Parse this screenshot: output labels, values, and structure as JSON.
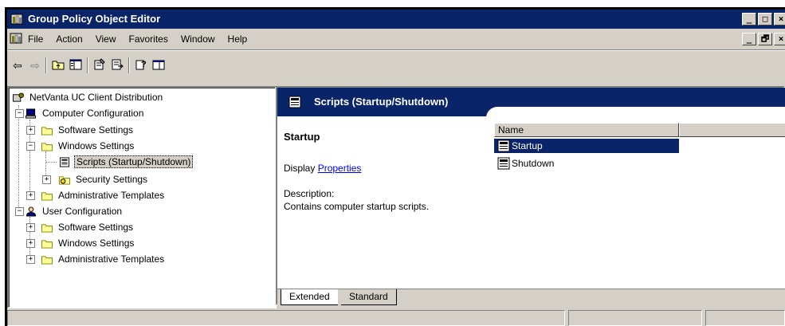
{
  "window": {
    "title": "Group Policy Object Editor",
    "buttons": {
      "minimize": "_",
      "maximize": "□",
      "close": "×"
    }
  },
  "menubar": {
    "items": [
      "File",
      "Action",
      "View",
      "Favorites",
      "Window",
      "Help"
    ],
    "mdi_buttons": {
      "minimize": "_",
      "restore": "🗗",
      "close": "×"
    }
  },
  "toolbar": {
    "back_glyph": "⇦",
    "forward_glyph": "⇨"
  },
  "tree": {
    "root": "NetVanta UC Client Distribution",
    "computer_config": "Computer Configuration",
    "cc_software": "Software Settings",
    "cc_windows": "Windows Settings",
    "cc_scripts": "Scripts (Startup/Shutdown)",
    "cc_security": "Security Settings",
    "cc_admin": "Administrative Templates",
    "user_config": "User Configuration",
    "uc_software": "Software Settings",
    "uc_windows": "Windows Settings",
    "uc_admin": "Administrative Templates",
    "plus": "+",
    "minus": "−"
  },
  "right_pane": {
    "header_title": "Scripts (Startup/Shutdown)",
    "desc_title": "Startup",
    "display_label": "Display",
    "properties_link": "Properties",
    "description_label": "Description:",
    "description_text": "Contains computer startup scripts.",
    "column_name": "Name",
    "items": [
      "Startup",
      "Shutdown"
    ],
    "tabs": [
      "Extended",
      "Standard"
    ]
  },
  "colors": {
    "titlebar": "#0a246a",
    "face": "#d4d0c8",
    "link": "#0000ff"
  }
}
